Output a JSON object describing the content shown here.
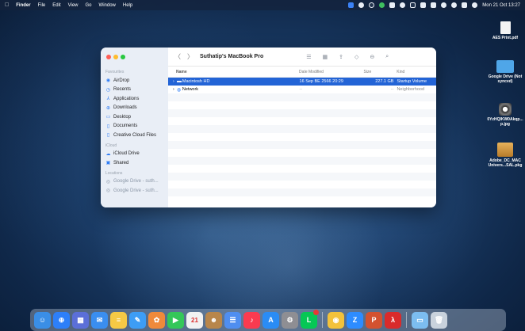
{
  "menubar": {
    "apple_icon": "apple-icon",
    "items": [
      "Finder",
      "File",
      "Edit",
      "View",
      "Go",
      "Window",
      "Help"
    ],
    "clock": "Mon 21 Oct 13:27"
  },
  "finder": {
    "title": "Suthatip's MacBook Pro",
    "sidebar": {
      "favourites_label": "Favourites",
      "favourites": [
        {
          "label": "AirDrop",
          "icon": "airdrop-icon"
        },
        {
          "label": "Recents",
          "icon": "clock-icon"
        },
        {
          "label": "Applications",
          "icon": "applications-icon"
        },
        {
          "label": "Downloads",
          "icon": "downloads-icon"
        },
        {
          "label": "Desktop",
          "icon": "desktop-icon"
        },
        {
          "label": "Documents",
          "icon": "document-icon"
        },
        {
          "label": "Creative Cloud Files",
          "icon": "document-icon"
        }
      ],
      "icloud_label": "iCloud",
      "icloud": [
        {
          "label": "iCloud Drive",
          "icon": "cloud-icon"
        },
        {
          "label": "Shared",
          "icon": "shared-folder-icon"
        }
      ],
      "locations_label": "Locations",
      "locations": [
        {
          "label": "Google Drive - suth...",
          "icon": "drive-icon"
        },
        {
          "label": "Google Drive - suth...",
          "icon": "drive-icon"
        }
      ]
    },
    "columns": {
      "name": "Name",
      "date": "Date Modified",
      "size": "Size",
      "kind": "Kind"
    },
    "rows": [
      {
        "name": "Macintosh HD",
        "date": "16 Sep BE 2566 20:29",
        "size": "227.1 GB",
        "kind": "Startup Volume",
        "selected": true
      },
      {
        "name": "Network",
        "date": "--",
        "size": "--",
        "kind": "Neighborhood",
        "selected": false
      }
    ]
  },
  "desktop_icons": [
    {
      "label": "AES Print.pdf",
      "icon": "pdf-document-icon"
    },
    {
      "label": "Google Drive (Not synced)",
      "icon": "folder-icon"
    },
    {
      "label": "0YzHQIKW0Akqp... p.jpg",
      "icon": "image-file-icon"
    },
    {
      "label": "Adobe_DC_MAC Univers...SAL.pkg",
      "icon": "package-icon"
    }
  ],
  "dock": {
    "apps": [
      {
        "name": "finder",
        "color": "#3a8ee6",
        "glyph": "☺"
      },
      {
        "name": "safari",
        "color": "#2d7ff9",
        "glyph": "⊕"
      },
      {
        "name": "launchpad",
        "color": "#5b6fd8",
        "glyph": "▦"
      },
      {
        "name": "mail",
        "color": "#3a8ef0",
        "glyph": "✉"
      },
      {
        "name": "notes",
        "color": "#f6c945",
        "glyph": "≡"
      },
      {
        "name": "freeform",
        "color": "#3d9df5",
        "glyph": "✎"
      },
      {
        "name": "photos",
        "color": "#f08a3b",
        "glyph": "✿"
      },
      {
        "name": "facetime",
        "color": "#34c759",
        "glyph": "▶"
      },
      {
        "name": "calendar",
        "color": "#f2f2f2",
        "glyph": "21"
      },
      {
        "name": "contacts",
        "color": "#b8864b",
        "glyph": "☻"
      },
      {
        "name": "reminders",
        "color": "#4f8ef0",
        "glyph": "☰"
      },
      {
        "name": "music",
        "color": "#fa3b4f",
        "glyph": "♪"
      },
      {
        "name": "app-store",
        "color": "#2a8cf5",
        "glyph": "A"
      },
      {
        "name": "system-settings",
        "color": "#8e8e93",
        "glyph": "⚙"
      },
      {
        "name": "line",
        "color": "#06c755",
        "glyph": "L"
      },
      {
        "name": "chrome",
        "color": "#f3c23b",
        "glyph": "◉"
      },
      {
        "name": "zoom",
        "color": "#2d8cff",
        "glyph": "Z"
      },
      {
        "name": "powerpoint",
        "color": "#d35230",
        "glyph": "P"
      },
      {
        "name": "acrobat",
        "color": "#d92b2b",
        "glyph": "λ"
      },
      {
        "name": "downloads-folder",
        "color": "#7cbdf0",
        "glyph": "▭"
      },
      {
        "name": "trash",
        "color": "#c9d2dc",
        "glyph": "🗑"
      }
    ]
  }
}
